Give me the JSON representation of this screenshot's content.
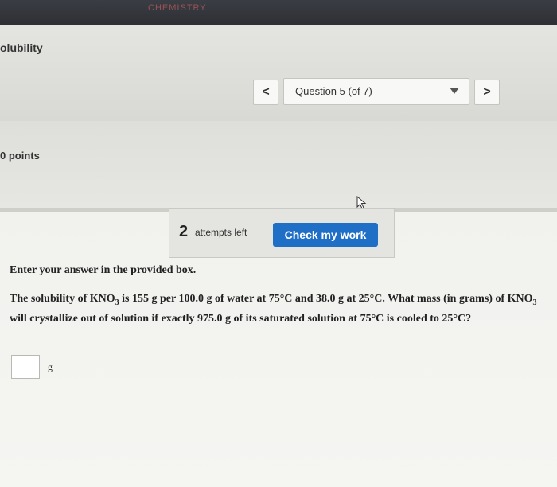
{
  "app": {
    "brand": "CHEMISTRY",
    "section_title": "olubility"
  },
  "navigation": {
    "prev_label": "<",
    "question_label": "Question 5 (of 7)",
    "next_label": ">"
  },
  "points_label": "0 points",
  "attempts": {
    "count": "2",
    "text": "attempts left"
  },
  "check_button": {
    "label": "Check my work",
    "color": "#1f6fc7"
  },
  "instruction": "Enter your answer in the provided box.",
  "question": {
    "part1": "The solubility of KNO",
    "sub1": "3",
    "part2": " is 155 g per 100.0 g of water at 75°C and 38.0 g at 25°C. What mass (in grams) of KNO",
    "sub2": "3",
    "part3": " will crystallize out of solution if exactly 975.0 g of its saturated solution at 75°C is cooled to 25°C?"
  },
  "answer": {
    "value": "",
    "unit": "g"
  },
  "icons": {
    "cursor": "mouse-pointer-icon",
    "dropdown": "caret-down-icon"
  }
}
